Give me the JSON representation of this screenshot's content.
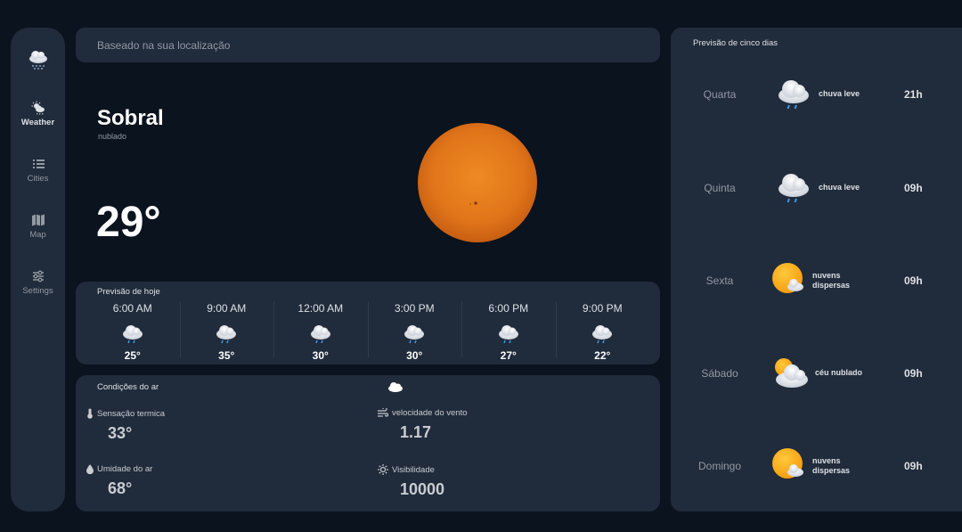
{
  "sidebar": {
    "logo_icon": "rain-cloud-icon",
    "items": [
      {
        "label": "Weather",
        "icon": "weather-icon",
        "active": true
      },
      {
        "label": "Cities",
        "icon": "list-icon",
        "active": false
      },
      {
        "label": "Map",
        "icon": "map-icon",
        "active": false
      },
      {
        "label": "Settings",
        "icon": "sliders-icon",
        "active": false
      }
    ]
  },
  "search": {
    "placeholder": "Baseado na sua localização"
  },
  "current": {
    "city": "Sobral",
    "description": "nublado",
    "temperature": "29°",
    "image": "sun-photo"
  },
  "today": {
    "title": "Previsão de hoje",
    "hours": [
      {
        "time": "6:00 AM",
        "temp": "25°",
        "icon": "light-rain-icon"
      },
      {
        "time": "9:00 AM",
        "temp": "35°",
        "icon": "light-rain-icon"
      },
      {
        "time": "12:00 AM",
        "temp": "30°",
        "icon": "light-rain-icon"
      },
      {
        "time": "3:00 PM",
        "temp": "30°",
        "icon": "light-rain-icon"
      },
      {
        "time": "6:00 PM",
        "temp": "27°",
        "icon": "light-rain-icon"
      },
      {
        "time": "9:00 PM",
        "temp": "22°",
        "icon": "light-rain-icon"
      }
    ]
  },
  "air": {
    "title": "Condições do ar",
    "icon": "cloud-icon",
    "feels_like": {
      "label": "Sensação termica",
      "value": "33°",
      "icon": "thermometer-icon"
    },
    "wind": {
      "label": "velocidade do vento",
      "value": "1.17",
      "icon": "wind-icon"
    },
    "humidity": {
      "label": "Umidade do ar",
      "value": "68°",
      "icon": "droplet-icon"
    },
    "visibility": {
      "label": "Visibilidade",
      "value": "10000",
      "icon": "sun-small-icon"
    }
  },
  "five_day": {
    "title": "Previsão de cinco dias",
    "days": [
      {
        "day": "Quarta",
        "condition": "chuva leve",
        "hour": "21h",
        "icon": "light-rain-icon"
      },
      {
        "day": "Quinta",
        "condition": "chuva leve",
        "hour": "09h",
        "icon": "light-rain-icon"
      },
      {
        "day": "Sexta",
        "condition_line1": "nuvens",
        "condition_line2": "dispersas",
        "hour": "09h",
        "icon": "sun-behind-cloud-icon"
      },
      {
        "day": "Sábado",
        "condition": "céu nublado",
        "hour": "09h",
        "icon": "cloudy-sun-icon"
      },
      {
        "day": "Domingo",
        "condition_line1": "nuvens",
        "condition_line2": "dispersas",
        "hour": "09h",
        "icon": "sun-behind-cloud-icon"
      }
    ]
  },
  "colors": {
    "background": "#0b131e",
    "panel": "#202b3b",
    "text_muted": "#9399a2",
    "sun": "#e67b18",
    "rain_drop": "#3f9ae6"
  }
}
